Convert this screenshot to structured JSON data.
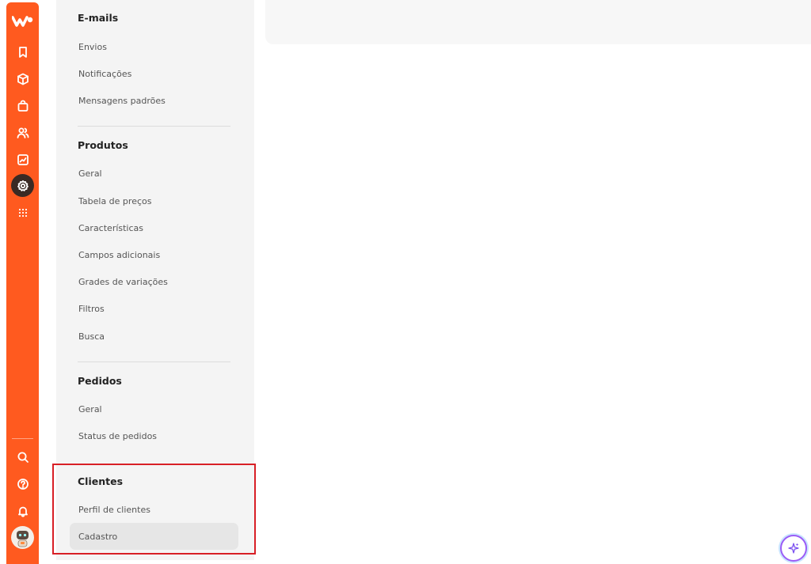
{
  "sidebar_icons": {
    "logo": "w-logo-icon",
    "items": [
      "bookmark-icon",
      "box-icon",
      "bag-icon",
      "users-icon",
      "chart-icon",
      "gear-icon",
      "apps-grid-icon"
    ],
    "bottom": [
      "search-icon",
      "help-icon",
      "bell-icon"
    ],
    "active": "gear-icon",
    "accent": "#ff5a1f"
  },
  "menu": {
    "emails": {
      "title": "E-mails",
      "items": [
        "Envios",
        "Notificações",
        "Mensagens padrões"
      ]
    },
    "produtos": {
      "title": "Produtos",
      "items": [
        "Geral",
        "Tabela de preços",
        "Características",
        "Campos adicionais",
        "Grades de variações",
        "Filtros",
        "Busca"
      ]
    },
    "pedidos": {
      "title": "Pedidos",
      "items": [
        "Geral",
        "Status de pedidos"
      ]
    },
    "clientes": {
      "title": "Clientes",
      "items": [
        "Perfil de clientes",
        "Cadastro"
      ],
      "selected": "Cadastro"
    }
  },
  "highlight_color": "#d81f26"
}
